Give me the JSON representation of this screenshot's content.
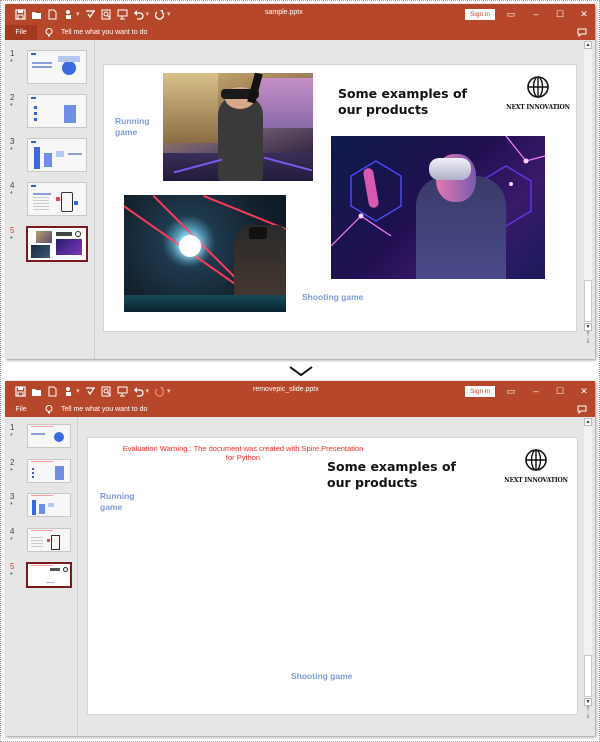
{
  "before_window": {
    "filename": "sample.pptx",
    "sign_in_label": "Sign in",
    "file_tab_label": "File",
    "tell_me_placeholder": "Tell me what you want to do",
    "thumbnails": [
      {
        "number": "1",
        "star": "*",
        "active": false
      },
      {
        "number": "2",
        "star": "*",
        "active": false
      },
      {
        "number": "3",
        "star": "*",
        "active": false
      },
      {
        "number": "4",
        "star": "*",
        "active": false
      },
      {
        "number": "5",
        "star": "*",
        "active": true
      }
    ],
    "slide": {
      "heading_line1": "Some examples of",
      "heading_line2": "our products",
      "logo_text": "NEXT INNOVATION",
      "label_running_line1": "Running",
      "label_running_line2": "game",
      "label_shooting": "Shooting game",
      "images": [
        {
          "name": "running-game-photo",
          "description": "woman wearing VR headset running"
        },
        {
          "name": "vr-man-photo",
          "description": "man wearing white VR headset with neon hexagons"
        },
        {
          "name": "shooting-game-photo",
          "description": "person in VR shooting game with red lasers"
        }
      ]
    }
  },
  "after_window": {
    "filename": "removepic_slide.pptx",
    "sign_in_label": "Sign in",
    "file_tab_label": "File",
    "tell_me_placeholder": "Tell me what you want to do",
    "thumbnails": [
      {
        "number": "1",
        "star": "*",
        "active": false
      },
      {
        "number": "2",
        "star": "*",
        "active": false
      },
      {
        "number": "3",
        "star": "*",
        "active": false
      },
      {
        "number": "4",
        "star": "*",
        "active": false
      },
      {
        "number": "5",
        "star": "*",
        "active": true
      }
    ],
    "slide": {
      "warning_line1": "Evaluation Warning : The document was created with Spire.Presentation",
      "warning_line2": "for Python",
      "heading_line1": "Some examples of",
      "heading_line2": "our products",
      "logo_text": "NEXT INNOVATION",
      "label_running_line1": "Running",
      "label_running_line2": "game",
      "label_shooting": "Shooting game"
    }
  },
  "colors": {
    "accent": "#b7472a",
    "label_blue": "#7c9bd4",
    "warning_red": "#ff2a2a",
    "active_thumb_border": "#7a1c1c"
  }
}
